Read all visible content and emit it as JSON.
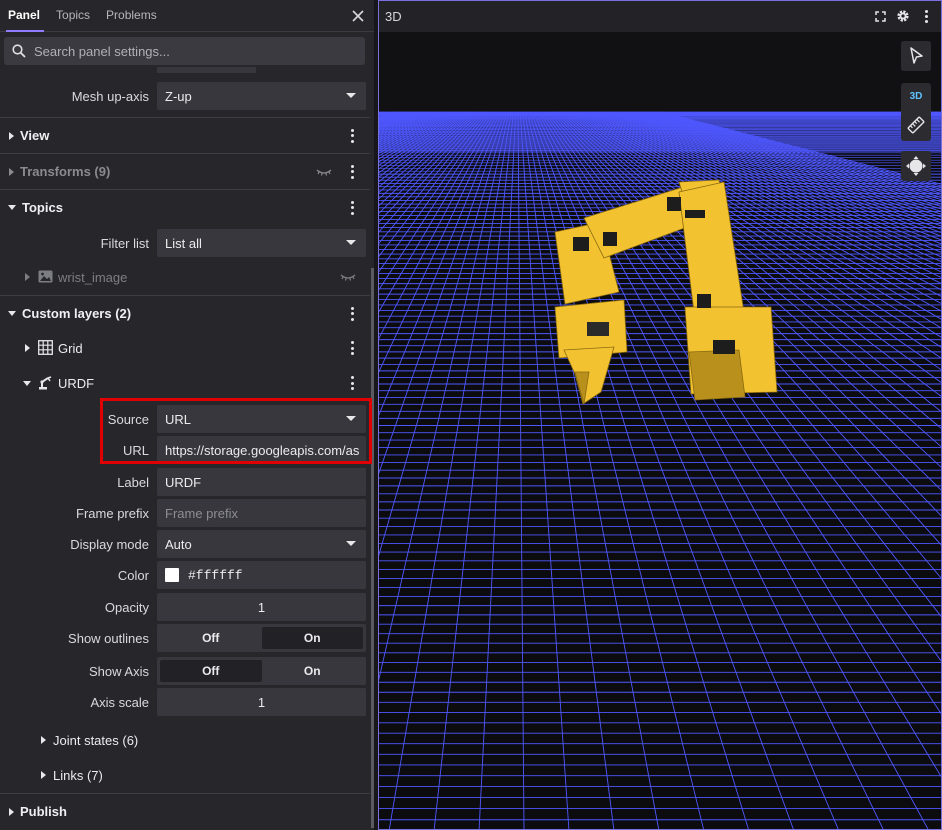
{
  "tabs": [
    {
      "label": "Panel",
      "active": true
    },
    {
      "label": "Topics",
      "active": false
    },
    {
      "label": "Problems",
      "active": false
    }
  ],
  "search": {
    "placeholder": "Search panel settings..."
  },
  "mesh_up_axis": {
    "label": "Mesh up-axis",
    "value": "Z-up"
  },
  "sections": {
    "view": "View",
    "transforms": "Transforms (9)",
    "topics": "Topics",
    "custom_layers": "Custom layers (2)",
    "publish": "Publish"
  },
  "filter_list": {
    "label": "Filter list",
    "value": "List all"
  },
  "wrist_image": "wrist_image",
  "layers": {
    "grid": "Grid",
    "urdf": "URDF"
  },
  "urdf_settings": {
    "source": {
      "label": "Source",
      "value": "URL"
    },
    "url": {
      "label": "URL",
      "value": "https://storage.googleapis.com/as"
    },
    "label": {
      "label": "Label",
      "value": "URDF"
    },
    "frame_prefix": {
      "label": "Frame prefix",
      "placeholder": "Frame prefix"
    },
    "display_mode": {
      "label": "Display mode",
      "value": "Auto"
    },
    "color": {
      "label": "Color",
      "value": "#ffffff",
      "swatch": "#ffffff"
    },
    "opacity": {
      "label": "Opacity",
      "value": "1"
    },
    "show_outlines": {
      "label": "Show outlines",
      "off": "Off",
      "on": "On",
      "selected": "Off"
    },
    "show_axis": {
      "label": "Show Axis",
      "off": "Off",
      "on": "On",
      "selected": "On"
    },
    "axis_scale": {
      "label": "Axis scale",
      "value": "1"
    },
    "joint_states": "Joint states (6)",
    "links": "Links (7)"
  },
  "viewport": {
    "title": "3D",
    "mode_badge": "3D",
    "colors": {
      "grid": "#4f58ff",
      "robot": "#f2c230",
      "accent": "#8f7cff",
      "highlight": "#e00000"
    },
    "icons": [
      "fullscreen-icon",
      "gear-icon",
      "more-vert-icon",
      "cursor-icon",
      "ruler-icon",
      "move-icon"
    ]
  }
}
